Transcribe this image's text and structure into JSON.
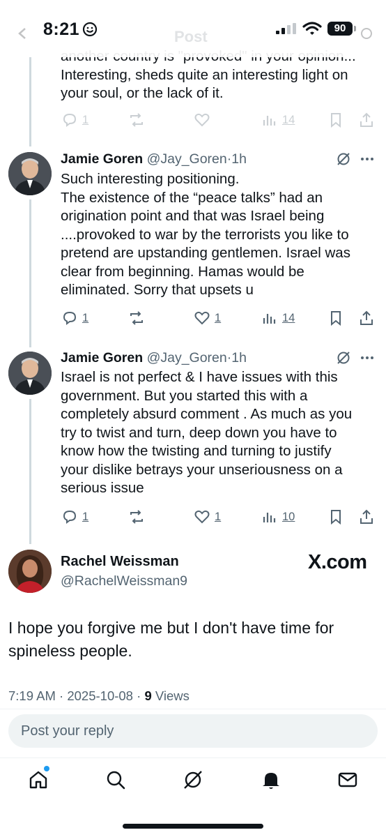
{
  "status_bar": {
    "time": "8:21",
    "battery": "90"
  },
  "header": {
    "title": "Post"
  },
  "thread": [
    {
      "text": "another country is \"provoked\" in your opinion...\nInteresting, sheds quite an interesting light on\nyour soul, or the lack of it.",
      "replies": "1",
      "views": "14"
    },
    {
      "name": "Jamie Goren",
      "handle": "@Jay_Goren",
      "dot": "·",
      "time": "1h",
      "text": "Such interesting positioning.\nThe existence of the “peace talks” had an\norigination point and that was Israel being\n....provoked to war by the terrorists you like to\npretend are  upstanding gentlemen. Israel was\nclear from beginning. Hamas would be\neliminated. Sorry that upsets u",
      "replies": "1",
      "likes": "1",
      "views": "14"
    },
    {
      "name": "Jamie Goren",
      "handle": "@Jay_Goren",
      "dot": "·",
      "time": "1h",
      "text": "Israel is not perfect & I have issues with this\ngovernment. But you started this with a\ncompletely absurd comment . As much as you\ntry to twist and turn, deep down you have to\nknow how the twisting and turning to justify\nyour dislike betrays your unseriousness on a\nserious issue",
      "replies": "1",
      "likes": "1",
      "views": "10"
    }
  ],
  "focal_post": {
    "name": "Rachel Weissman",
    "handle": "@RachelWeissman9",
    "watermark": "X.com",
    "text": "I hope you forgive me but I don't have time for spineless people.",
    "time": "7:19 AM",
    "date": "2025-10-08",
    "sep": "·",
    "views_count": "9",
    "views_label": "Views"
  },
  "reply_box": {
    "placeholder": "Post your reply"
  },
  "nav": {
    "items": [
      "home-icon",
      "search-icon",
      "grok-icon",
      "notifications-icon",
      "messages-icon"
    ]
  },
  "colors": {
    "text": "#0f1419",
    "secondary": "#536471",
    "accent": "#1d9bf0",
    "line": "#cfd9de"
  }
}
